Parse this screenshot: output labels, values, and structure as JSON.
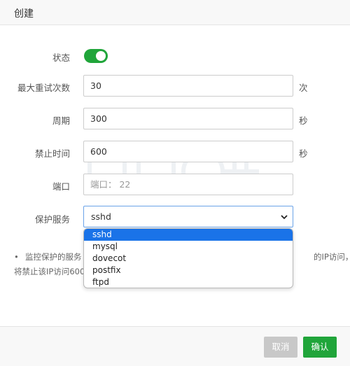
{
  "dialog": {
    "title": "创建"
  },
  "form": {
    "status": {
      "label": "状态",
      "enabled": true
    },
    "max_retries": {
      "label": "最大重试次数",
      "value": "30",
      "unit": "次"
    },
    "period": {
      "label": "周期",
      "value": "300",
      "unit": "秒"
    },
    "ban_time": {
      "label": "禁止时间",
      "value": "600",
      "unit": "秒"
    },
    "port": {
      "label": "端口",
      "placeholder": "端口： 22"
    },
    "service": {
      "label": "保护服务",
      "selected": "sshd",
      "options": [
        "sshd",
        "mysql",
        "dovecot",
        "postfix",
        "ftpd"
      ]
    }
  },
  "tip": {
    "bullet": "•",
    "line1_start": "监控保护的服务",
    "line1_end": "的IP访问，",
    "line2": "将禁止该IP访问600"
  },
  "footer": {
    "cancel_label": "取消",
    "confirm_label": "确认"
  },
  "colors": {
    "accent": "#20a53a",
    "select_highlight": "#1a73e8",
    "cancel_bg": "#c8c8c8"
  }
}
